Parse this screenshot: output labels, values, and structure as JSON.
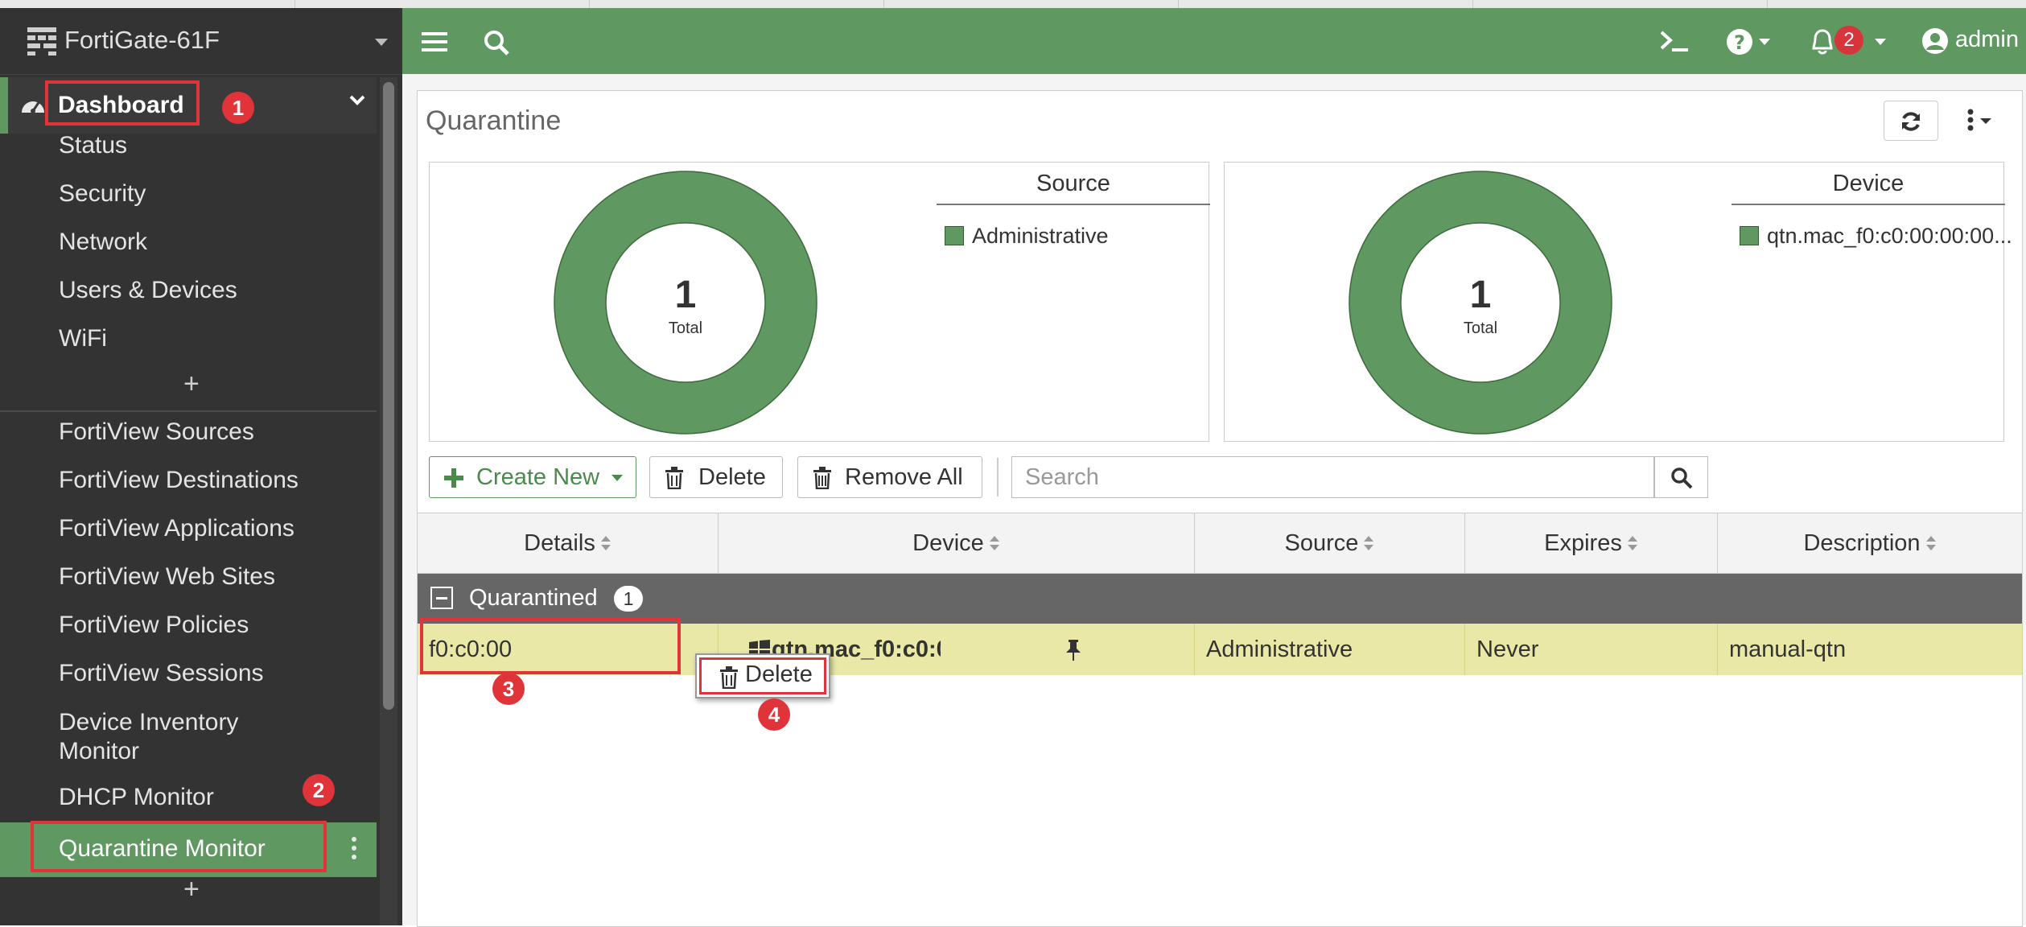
{
  "sidebar": {
    "device_name": "FortiGate-61F",
    "section_label": "Dashboard",
    "dashboard_items": [
      "Status",
      "Security",
      "Network",
      "Users & Devices",
      "WiFi"
    ],
    "plus_label": "+",
    "monitor_items": [
      "FortiView Sources",
      "FortiView Destinations",
      "FortiView Applications",
      "FortiView Web Sites",
      "FortiView Policies",
      "FortiView Sessions",
      "Device Inventory Monitor",
      "DHCP Monitor"
    ],
    "active_item": "Quarantine Monitor"
  },
  "header": {
    "notification_count": "2",
    "user_name": "admin"
  },
  "panel": {
    "title": "Quarantine"
  },
  "cards": [
    {
      "legend_title": "Source",
      "legend_items": [
        "Administrative"
      ],
      "center_value": "1",
      "center_label": "Total"
    },
    {
      "legend_title": "Device",
      "legend_items": [
        "qtn.mac_f0:c0:00:00:00..."
      ],
      "center_value": "1",
      "center_label": "Total"
    }
  ],
  "toolbar": {
    "create_new": "Create New",
    "delete": "Delete",
    "remove_all": "Remove All",
    "search_placeholder": "Search"
  },
  "table": {
    "columns": [
      "Details",
      "Device",
      "Source",
      "Expires",
      "Description"
    ],
    "group": {
      "label": "Quarantined",
      "count": "1"
    },
    "rows": [
      {
        "details": "f0:c0:00",
        "device": "qtn.mac_f0:c0:0(",
        "source": "Administrative",
        "expires": "Never",
        "description": "manual-qtn"
      }
    ]
  },
  "context_menu": {
    "delete": "Delete"
  },
  "annotations": [
    "1",
    "2",
    "3",
    "4"
  ],
  "colors": {
    "accent_green": "#5f9860",
    "sidebar_bg": "#333333",
    "highlight_red": "#e0333a",
    "row_highlight": "#e9e8a6"
  }
}
